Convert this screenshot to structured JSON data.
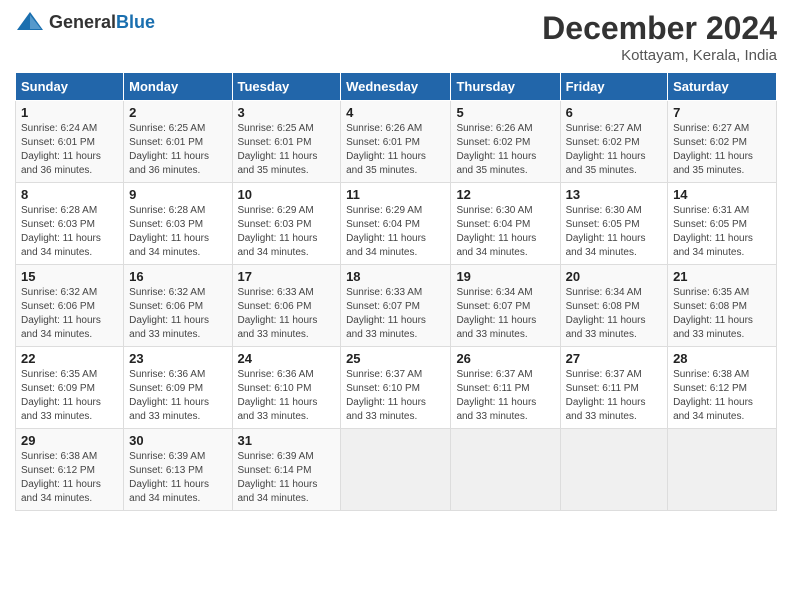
{
  "header": {
    "logo_general": "General",
    "logo_blue": "Blue",
    "title": "December 2024",
    "location": "Kottayam, Kerala, India"
  },
  "weekdays": [
    "Sunday",
    "Monday",
    "Tuesday",
    "Wednesday",
    "Thursday",
    "Friday",
    "Saturday"
  ],
  "weeks": [
    [
      {
        "day": "1",
        "info": "Sunrise: 6:24 AM\nSunset: 6:01 PM\nDaylight: 11 hours\nand 36 minutes."
      },
      {
        "day": "2",
        "info": "Sunrise: 6:25 AM\nSunset: 6:01 PM\nDaylight: 11 hours\nand 36 minutes."
      },
      {
        "day": "3",
        "info": "Sunrise: 6:25 AM\nSunset: 6:01 PM\nDaylight: 11 hours\nand 35 minutes."
      },
      {
        "day": "4",
        "info": "Sunrise: 6:26 AM\nSunset: 6:01 PM\nDaylight: 11 hours\nand 35 minutes."
      },
      {
        "day": "5",
        "info": "Sunrise: 6:26 AM\nSunset: 6:02 PM\nDaylight: 11 hours\nand 35 minutes."
      },
      {
        "day": "6",
        "info": "Sunrise: 6:27 AM\nSunset: 6:02 PM\nDaylight: 11 hours\nand 35 minutes."
      },
      {
        "day": "7",
        "info": "Sunrise: 6:27 AM\nSunset: 6:02 PM\nDaylight: 11 hours\nand 35 minutes."
      }
    ],
    [
      {
        "day": "8",
        "info": "Sunrise: 6:28 AM\nSunset: 6:03 PM\nDaylight: 11 hours\nand 34 minutes."
      },
      {
        "day": "9",
        "info": "Sunrise: 6:28 AM\nSunset: 6:03 PM\nDaylight: 11 hours\nand 34 minutes."
      },
      {
        "day": "10",
        "info": "Sunrise: 6:29 AM\nSunset: 6:03 PM\nDaylight: 11 hours\nand 34 minutes."
      },
      {
        "day": "11",
        "info": "Sunrise: 6:29 AM\nSunset: 6:04 PM\nDaylight: 11 hours\nand 34 minutes."
      },
      {
        "day": "12",
        "info": "Sunrise: 6:30 AM\nSunset: 6:04 PM\nDaylight: 11 hours\nand 34 minutes."
      },
      {
        "day": "13",
        "info": "Sunrise: 6:30 AM\nSunset: 6:05 PM\nDaylight: 11 hours\nand 34 minutes."
      },
      {
        "day": "14",
        "info": "Sunrise: 6:31 AM\nSunset: 6:05 PM\nDaylight: 11 hours\nand 34 minutes."
      }
    ],
    [
      {
        "day": "15",
        "info": "Sunrise: 6:32 AM\nSunset: 6:06 PM\nDaylight: 11 hours\nand 34 minutes."
      },
      {
        "day": "16",
        "info": "Sunrise: 6:32 AM\nSunset: 6:06 PM\nDaylight: 11 hours\nand 33 minutes."
      },
      {
        "day": "17",
        "info": "Sunrise: 6:33 AM\nSunset: 6:06 PM\nDaylight: 11 hours\nand 33 minutes."
      },
      {
        "day": "18",
        "info": "Sunrise: 6:33 AM\nSunset: 6:07 PM\nDaylight: 11 hours\nand 33 minutes."
      },
      {
        "day": "19",
        "info": "Sunrise: 6:34 AM\nSunset: 6:07 PM\nDaylight: 11 hours\nand 33 minutes."
      },
      {
        "day": "20",
        "info": "Sunrise: 6:34 AM\nSunset: 6:08 PM\nDaylight: 11 hours\nand 33 minutes."
      },
      {
        "day": "21",
        "info": "Sunrise: 6:35 AM\nSunset: 6:08 PM\nDaylight: 11 hours\nand 33 minutes."
      }
    ],
    [
      {
        "day": "22",
        "info": "Sunrise: 6:35 AM\nSunset: 6:09 PM\nDaylight: 11 hours\nand 33 minutes."
      },
      {
        "day": "23",
        "info": "Sunrise: 6:36 AM\nSunset: 6:09 PM\nDaylight: 11 hours\nand 33 minutes."
      },
      {
        "day": "24",
        "info": "Sunrise: 6:36 AM\nSunset: 6:10 PM\nDaylight: 11 hours\nand 33 minutes."
      },
      {
        "day": "25",
        "info": "Sunrise: 6:37 AM\nSunset: 6:10 PM\nDaylight: 11 hours\nand 33 minutes."
      },
      {
        "day": "26",
        "info": "Sunrise: 6:37 AM\nSunset: 6:11 PM\nDaylight: 11 hours\nand 33 minutes."
      },
      {
        "day": "27",
        "info": "Sunrise: 6:37 AM\nSunset: 6:11 PM\nDaylight: 11 hours\nand 33 minutes."
      },
      {
        "day": "28",
        "info": "Sunrise: 6:38 AM\nSunset: 6:12 PM\nDaylight: 11 hours\nand 34 minutes."
      }
    ],
    [
      {
        "day": "29",
        "info": "Sunrise: 6:38 AM\nSunset: 6:12 PM\nDaylight: 11 hours\nand 34 minutes."
      },
      {
        "day": "30",
        "info": "Sunrise: 6:39 AM\nSunset: 6:13 PM\nDaylight: 11 hours\nand 34 minutes."
      },
      {
        "day": "31",
        "info": "Sunrise: 6:39 AM\nSunset: 6:14 PM\nDaylight: 11 hours\nand 34 minutes."
      },
      null,
      null,
      null,
      null
    ]
  ]
}
